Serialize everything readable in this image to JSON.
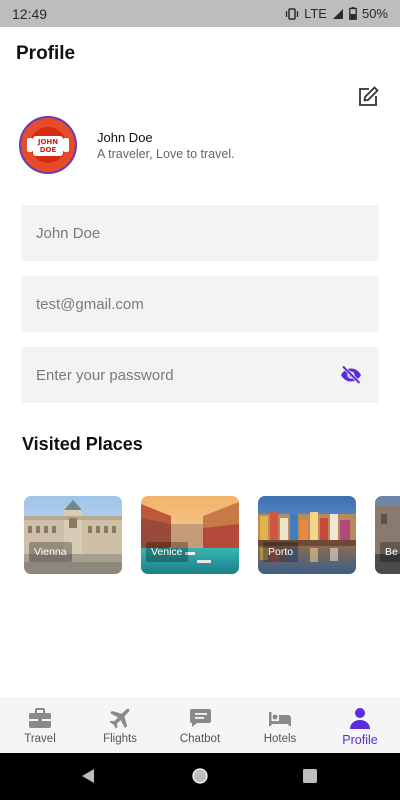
{
  "status_bar": {
    "time": "12:49",
    "network": "LTE",
    "battery": "50%"
  },
  "page": {
    "title": "Profile"
  },
  "profile": {
    "avatar_line1": "JOHN",
    "avatar_line2": "DOE",
    "name": "John Doe",
    "bio": "A traveler, Love to travel."
  },
  "form": {
    "name_placeholder": "John Doe",
    "email_placeholder": "test@gmail.com",
    "password_placeholder": "Enter your password"
  },
  "visited": {
    "title": "Visited Places",
    "places": [
      {
        "label": "Vienna"
      },
      {
        "label": "Venice"
      },
      {
        "label": "Porto"
      },
      {
        "label": "Be"
      }
    ]
  },
  "bottom_nav": {
    "items": [
      {
        "label": "Travel",
        "icon": "briefcase-icon"
      },
      {
        "label": "Flights",
        "icon": "airplane-icon"
      },
      {
        "label": "Chatbot",
        "icon": "chat-icon"
      },
      {
        "label": "Hotels",
        "icon": "bed-icon"
      },
      {
        "label": "Profile",
        "icon": "person-icon",
        "active": true
      }
    ]
  },
  "colors": {
    "accent": "#5b2bdc",
    "field_bg": "#f3f3f3",
    "nav_inactive": "#8a8a8a",
    "status_bar": "#bdbdbd"
  }
}
